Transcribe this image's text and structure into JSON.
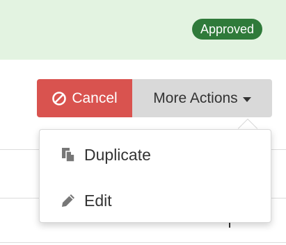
{
  "status": {
    "badge_label": "Approved",
    "badge_color": "#2f7a3a",
    "bar_color": "#e3f3e1"
  },
  "actions": {
    "cancel_label": "Cancel",
    "cancel_icon": "ban-icon",
    "cancel_color": "#d9534f",
    "more_actions_label": "More Actions",
    "more_actions_icon": "caret-down-icon"
  },
  "dropdown": {
    "items": [
      {
        "label": "Duplicate",
        "icon": "copy-icon"
      },
      {
        "label": "Edit",
        "icon": "pencil-icon"
      }
    ]
  }
}
